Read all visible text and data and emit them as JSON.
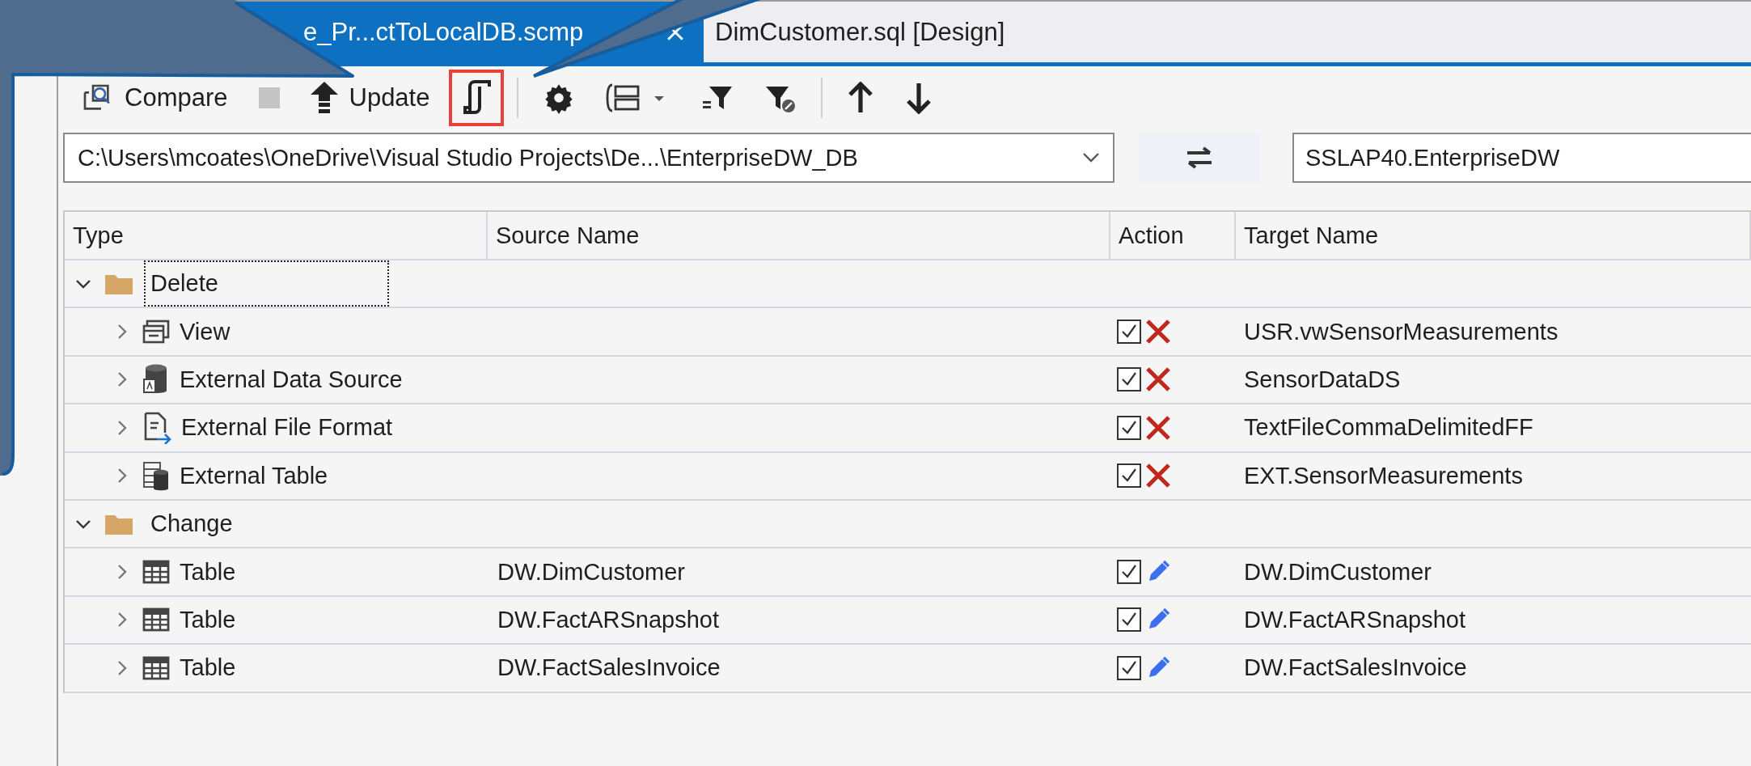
{
  "tabs": [
    {
      "label": "e_Pr...ctToLocalDB.scmp",
      "selected": true
    },
    {
      "label": "DimCustomer.sql [Design]",
      "selected": false
    }
  ],
  "toolbar": [
    {
      "kind": "compare",
      "label": "Compare",
      "highlighted": false
    },
    {
      "kind": "stop",
      "highlighted": false
    },
    {
      "kind": "update",
      "label": "Update",
      "highlighted": false
    },
    {
      "kind": "script",
      "highlighted": true
    },
    {
      "kind": "separator"
    },
    {
      "kind": "options",
      "highlighted": false
    },
    {
      "kind": "group",
      "highlighted": false
    },
    {
      "kind": "filter",
      "highlighted": false
    },
    {
      "kind": "filter-clear",
      "highlighted": false
    },
    {
      "kind": "separator"
    },
    {
      "kind": "up",
      "highlighted": false
    },
    {
      "kind": "down",
      "highlighted": false
    }
  ],
  "source": {
    "value": "C:\\Users\\mcoates\\OneDrive\\Visual Studio Projects\\De...\\EnterpriseDW_DB"
  },
  "target": {
    "value": "SSLAP40.EnterpriseDW"
  },
  "grid": {
    "columns": [
      "Type",
      "Source Name",
      "Action",
      "Target Name"
    ],
    "groups": [
      {
        "label": "Delete",
        "expanded": true,
        "focused": true,
        "rows": [
          {
            "kind": "view",
            "type": "View",
            "action": {
              "kind": "delete",
              "checked": true
            },
            "target": "USR.vwSensorMeasurements",
            "expanded": false
          },
          {
            "kind": "data-source",
            "type": "External Data Source",
            "action": {
              "kind": "delete",
              "checked": true
            },
            "target": "SensorDataDS",
            "expanded": false
          },
          {
            "kind": "file-format",
            "type": "External File Format",
            "action": {
              "kind": "delete",
              "checked": true
            },
            "target": "TextFileCommaDelimitedFF",
            "expanded": false
          },
          {
            "kind": "external-table",
            "type": "External Table",
            "action": {
              "kind": "delete",
              "checked": true
            },
            "target": "EXT.SensorMeasurements",
            "expanded": false
          }
        ]
      },
      {
        "label": "Change",
        "expanded": true,
        "focused": false,
        "rows": [
          {
            "kind": "table",
            "type": "Table",
            "source": "DW.DimCustomer",
            "action": {
              "kind": "change",
              "checked": true
            },
            "target": "DW.DimCustomer",
            "expanded": false
          },
          {
            "kind": "table",
            "type": "Table",
            "source": "DW.FactARSnapshot",
            "action": {
              "kind": "change",
              "checked": true
            },
            "target": "DW.FactARSnapshot",
            "expanded": false
          },
          {
            "kind": "table",
            "type": "Table",
            "source": "DW.FactSalesInvoice",
            "action": {
              "kind": "change",
              "checked": true
            },
            "target": "DW.FactSalesInvoice",
            "expanded": false
          }
        ]
      }
    ]
  }
}
